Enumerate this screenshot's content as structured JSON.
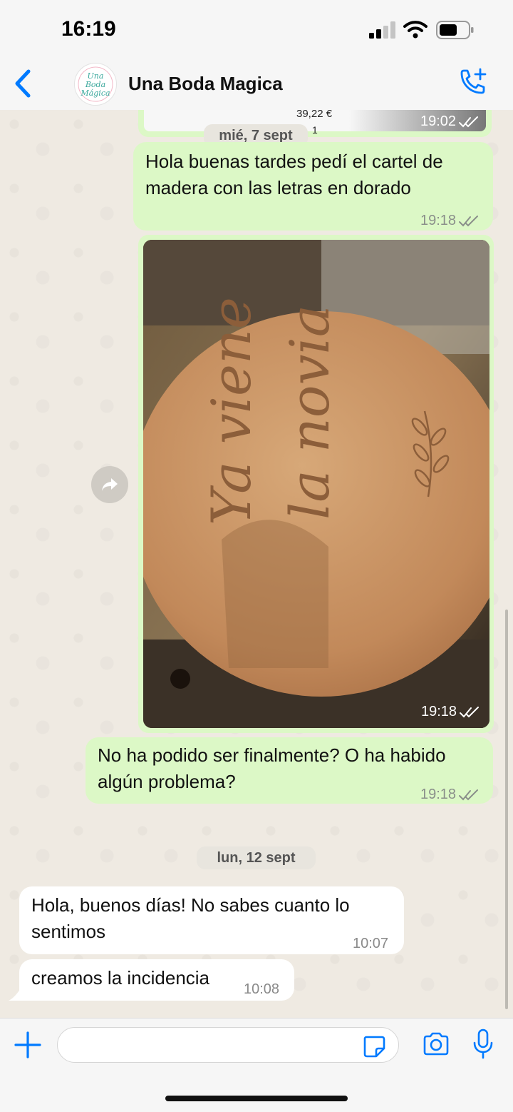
{
  "status": {
    "time": "16:19"
  },
  "header": {
    "contact_name": "Una Boda Magica",
    "avatar_text": "Una Boda Mágica"
  },
  "partial_message": {
    "price": "39,22 €",
    "qty": "1",
    "time": "19:02"
  },
  "dates": {
    "first": "mié, 7 sept",
    "second": "lun, 12 sept"
  },
  "messages": [
    {
      "text": "Hola buenas tardes pedí el cartel de madera con las letras en dorado",
      "time": "19:18",
      "outgoing": true
    },
    {
      "text": "",
      "time": "19:18",
      "outgoing": true,
      "photo_engraving": [
        "Ya viene",
        "la novia"
      ]
    },
    {
      "text": "No ha podido ser finalmente? O ha habido algún problema?",
      "time": "19:18",
      "outgoing": true
    },
    {
      "text": "Hola, buenos días! No sabes cuanto lo sentimos",
      "time": "10:07",
      "outgoing": false
    },
    {
      "text": "creamos la incidencia",
      "time": "10:08",
      "outgoing": false
    }
  ],
  "composer": {
    "value": "",
    "placeholder": ""
  },
  "colors": {
    "accent": "#007aff",
    "outgoing_bubble": "#dcf8c6",
    "incoming_bubble": "#ffffff",
    "tick": "#8a8f8a"
  },
  "icons": [
    "back-chevron-icon",
    "add-call-icon",
    "forward-icon",
    "plus-icon",
    "sticker-icon",
    "camera-icon",
    "mic-icon",
    "double-check-icon"
  ]
}
